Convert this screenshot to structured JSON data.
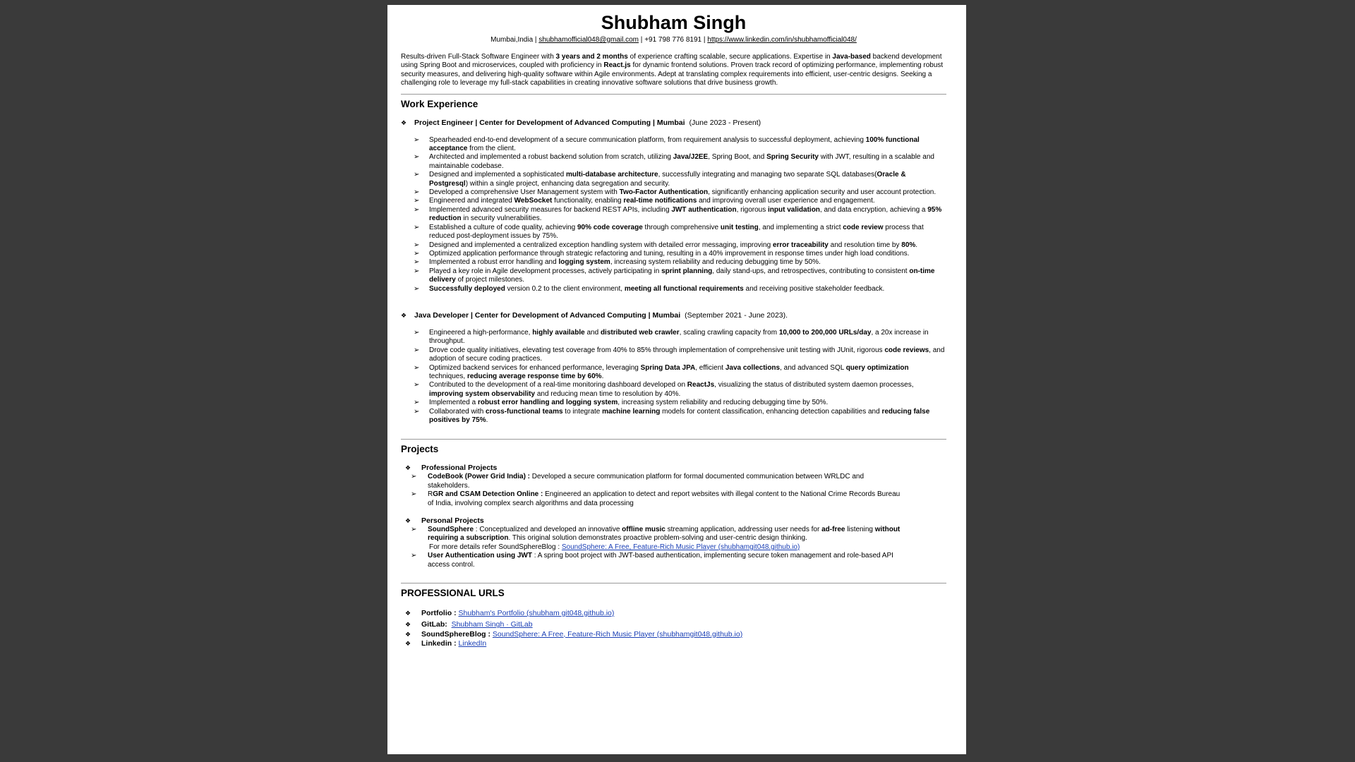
{
  "header": {
    "name": "Shubham Singh",
    "location": "Mumbai,India",
    "sep1": " | ",
    "email": "shubhamofficial048@gmail.com",
    "sep2": " | ",
    "phone": "+91 798 776 8191",
    "sep3": " | ",
    "linkedin": "https://www.linkedin.com/in/shubhamofficial048/"
  },
  "summary": {
    "p1": "Results-driven Full-Stack Software Engineer with ",
    "b1": "3 years and 2 months",
    "p2": " of experience crafting scalable, secure applications. Expertise in ",
    "b2": "Java-based",
    "p3": " backend development using Spring Boot and microservices, coupled with proficiency in ",
    "b3": "React.js",
    "p4": " for dynamic frontend solutions. Proven track record of optimizing performance, implementing robust security measures, and delivering high-quality software within Agile environments. Adept at translating complex requirements into efficient, user-centric designs. Seeking a challenging role to leverage my full-stack capabilities in creating innovative software solutions that drive business growth."
  },
  "work": {
    "heading": "Work Experience",
    "jobs": [
      {
        "title": "Project Engineer | Center for Development of Advanced Computing | Mumbai",
        "dates": "(June 2023 - Present)",
        "bullets": [
          {
            "p1": "Spearheaded end-to-end development of a secure communication platform, from requirement analysis to successful deployment, achieving ",
            "b1": "100% functional acceptance",
            "p2": " from the client."
          },
          {
            "p1": "Architected and implemented a robust backend solution from scratch, utilizing ",
            "b1": "Java/J2EE",
            "p2": ", Spring Boot, and ",
            "b2": "Spring Security",
            "p3": " with JWT, resulting in a scalable and maintainable codebase."
          },
          {
            "p1": "Designed and implemented a sophisticated ",
            "b1": "multi-database architecture",
            "p2": ", successfully integrating and managing two separate SQL databases(",
            "b2": "Oracle & Postgresql",
            "p3": ") within a single project, enhancing data segregation and security."
          },
          {
            "p1": "Developed a comprehensive User Management system with ",
            "b1": "Two-Factor Authentication",
            "p2": ", significantly enhancing application security and user account protection."
          },
          {
            "p1": "Engineered and integrated ",
            "b1": "WebSocket",
            "p2": " functionality, enabling ",
            "b2": "real-time notifications",
            "p3": " and improving overall user experience and engagement."
          },
          {
            "p1": "Implemented advanced security measures for backend REST APIs, including ",
            "b1": "JWT authentication",
            "p2": ", rigorous ",
            "b2": "input validation",
            "p3": ", and data encryption, achieving a ",
            "b3": "95% reduction",
            "p4": " in security vulnerabilities."
          },
          {
            "p1": "Established a culture of code quality, achieving ",
            "b1": "90% code coverage",
            "p2": " through comprehensive ",
            "b2": "unit testing",
            "p3": ", and implementing a strict ",
            "b3": "code review",
            "p4": " process that reduced post-deployment issues by 75%."
          },
          {
            "p1": "Designed and implemented a centralized exception handling system with detailed error messaging, improving ",
            "b1": "error traceability",
            "p2": " and resolution time by ",
            "b2": "80%",
            "p3": "."
          },
          {
            "p1": "Optimized application performance through strategic refactoring and tuning, resulting in a 40% improvement in response times under high load conditions."
          },
          {
            "p1": "Implemented a robust error handling and ",
            "b1": "logging system",
            "p2": ", increasing system reliability and reducing debugging time by 50%."
          },
          {
            "p1": "Played a key role in Agile development processes, actively participating in ",
            "b1": "sprint planning",
            "p2": ", daily stand-ups, and retrospectives, contributing to consistent ",
            "b2": "on-time delivery",
            "p3": " of project milestones."
          },
          {
            "b1": "Successfully deployed",
            "p2": " version 0.2 to the client environment, ",
            "b2": "meeting all functional requirements",
            "p3": " and receiving positive stakeholder feedback."
          }
        ]
      },
      {
        "title": "Java Developer | Center for Development of Advanced Computing | Mumbai",
        "dates": "(September 2021 - June 2023).",
        "bullets": [
          {
            "p1": "Engineered a high-performance, ",
            "b1": "highly available",
            "p2": " and ",
            "b2": "distributed web crawler",
            "p3": ", scaling crawling capacity from ",
            "b3": "10,000 to 200,000 URLs/day",
            "p4": ", a 20x increase in throughput."
          },
          {
            "p1": "Drove code quality initiatives, elevating test coverage from 40% to 85% through implementation of comprehensive unit testing with JUnit, rigorous ",
            "b1": "code reviews",
            "p2": ", and adoption of secure coding practices."
          },
          {
            "p1": "Optimized backend services for enhanced performance, leveraging ",
            "b1": "Spring Data JPA",
            "p2": ", efficient ",
            "b2": "Java collections",
            "p3": ", and advanced SQL ",
            "b3": "query optimization",
            "p4": " techniques, ",
            "b4": "reducing average response time by 60%",
            "p5": "."
          },
          {
            "p1": "Contributed to the development of a real-time monitoring dashboard developed on ",
            "b1": "ReactJs",
            "p2": ", visualizing the status of distributed system daemon processes, ",
            "b2": "improving system observability",
            "p3": " and reducing mean time to resolution by 40%."
          },
          {
            "p1": "Implemented a ",
            "b1": "robust error handling and logging system",
            "p2": ", increasing system reliability and reducing debugging time by 50%."
          },
          {
            "p1": "Collaborated with ",
            "b1": "cross-functional teams",
            "p2": " to integrate ",
            "b2": "machine learning",
            "p3": " models for content classification, enhancing detection capabilities and ",
            "b3": "reducing false positives by 75%",
            "p4": "."
          }
        ]
      }
    ]
  },
  "projects": {
    "heading": "Projects",
    "professional_heading": "Professional Projects",
    "professional": [
      {
        "b1": "CodeBook (Power Grid India) :",
        "p1": " Developed a secure communication platform for formal documented communication between WRLDC and stakeholders."
      },
      {
        "p0": "R",
        "b1": "GR and CSAM Detection Online :",
        "p1": " Engineered an application to detect and report websites with illegal content to the National Crime Records Bureau of India, involving complex search algorithms and data processing"
      }
    ],
    "personal_heading": "Personal Projects",
    "personal": [
      {
        "b1": "SoundSphere",
        "p1": " : Conceptualized and developed an innovative ",
        "b2": "offline music",
        "p2": " streaming application, addressing user needs for ",
        "b3": "ad-free",
        "p3": " listening ",
        "b4": "without requiring a subscription",
        "p4": ". This original solution demonstrates proactive problem-solving and user-centric design thinking.",
        "more": "For more details refer SoundSphereBlog : ",
        "link": "SoundSphere: A Free, Feature-Rich Music Player (shubhamgit048.github.io)"
      },
      {
        "b1": "User Authentication using JWT",
        "p1": " : A spring boot project with JWT-based authentication, implementing secure token management and role-based API access control."
      }
    ]
  },
  "urls": {
    "heading": "PROFESSIONAL URLS",
    "items": [
      {
        "label": "Portfolio :",
        "link": "Shubham's Portfolio (shubham git048.github.io)"
      },
      {
        "label": "GitLab:",
        "link": "Shubham Singh · GitLab"
      },
      {
        "label": "SoundSphereBlog :",
        "link": "SoundSphere: A Free, Feature-Rich Music Player (shubhamgit048.github.io)"
      },
      {
        "label": "Linkedin :",
        "link": "LinkedIn"
      }
    ]
  },
  "glyphs": {
    "diamond": "❖",
    "arrow": "➢"
  }
}
